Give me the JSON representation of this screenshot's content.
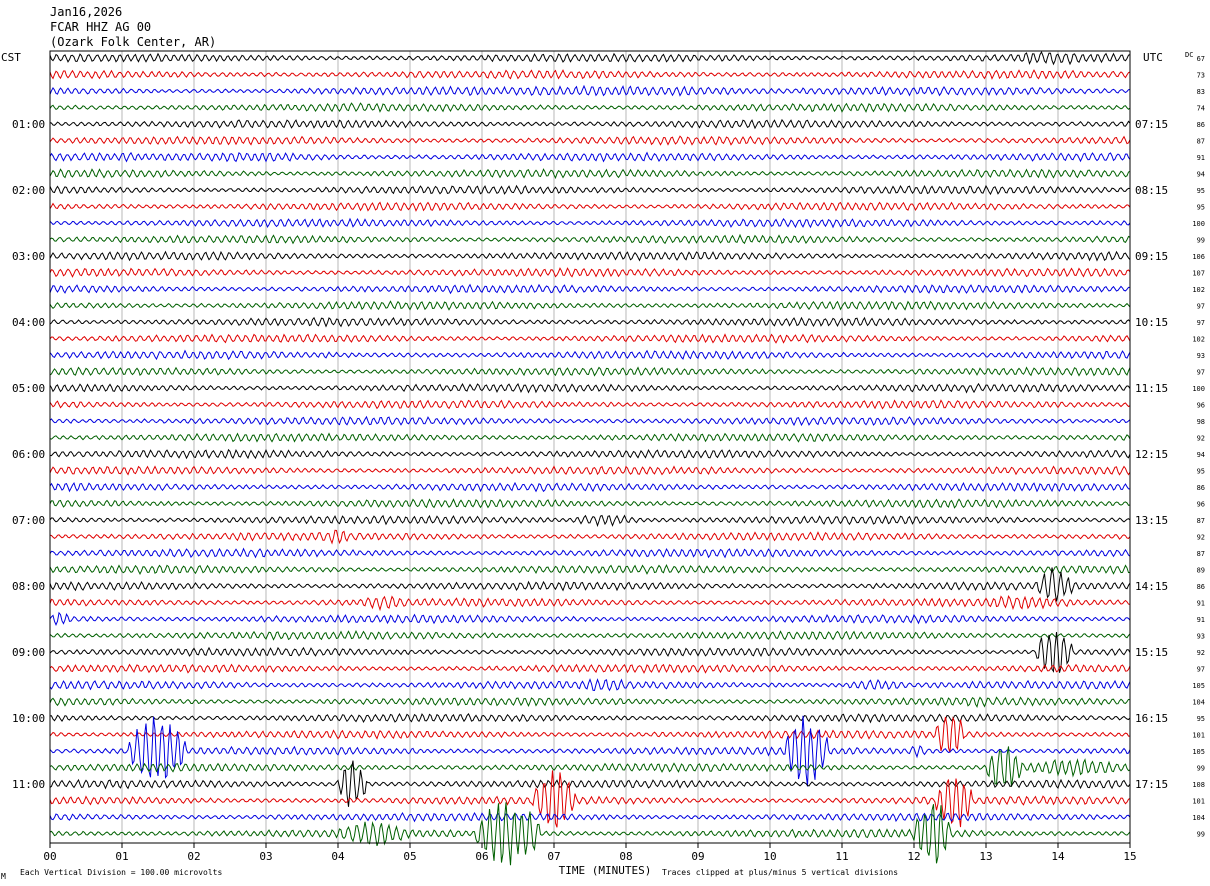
{
  "header": {
    "date": "Jan16,2026",
    "station": "FCAR HHZ AG 00",
    "location": "(Ozark Folk Center, AR)"
  },
  "axes": {
    "left_tz": "CST",
    "right_tz": "UTC",
    "dc_label": "DC",
    "xlabel": "TIME (MINUTES)",
    "xticks": [
      "00",
      "01",
      "02",
      "03",
      "04",
      "05",
      "06",
      "07",
      "08",
      "09",
      "10",
      "11",
      "12",
      "13",
      "14",
      "15"
    ]
  },
  "footer": {
    "left_note": "Each Vertical Division =  100.00 microvolts",
    "right_note": "Traces clipped at plus/minus 5 vertical divisions",
    "corner_mark": "M"
  },
  "colors": {
    "trace_cycle": [
      "#000000",
      "#e00000",
      "#0000e0",
      "#006000"
    ],
    "grid": "#888888"
  },
  "chart_data": {
    "type": "helicorder",
    "title": "FCAR HHZ AG 00 (Ozark Folk Center, AR) Jan16,2026",
    "xlabel": "TIME (MINUTES)",
    "xlim": [
      0,
      15
    ],
    "minutes_per_line": 15,
    "left_hour_labels": [
      {
        "line": 4,
        "label": "01:00"
      },
      {
        "line": 8,
        "label": "02:00"
      },
      {
        "line": 12,
        "label": "03:00"
      },
      {
        "line": 16,
        "label": "04:00"
      },
      {
        "line": 20,
        "label": "05:00"
      },
      {
        "line": 24,
        "label": "06:00"
      },
      {
        "line": 28,
        "label": "07:00"
      },
      {
        "line": 32,
        "label": "08:00"
      },
      {
        "line": 36,
        "label": "09:00"
      },
      {
        "line": 40,
        "label": "10:00"
      },
      {
        "line": 44,
        "label": "11:00"
      }
    ],
    "right_hour_labels": [
      {
        "line": 4,
        "label": "07:15"
      },
      {
        "line": 8,
        "label": "08:15"
      },
      {
        "line": 12,
        "label": "09:15"
      },
      {
        "line": 16,
        "label": "10:15"
      },
      {
        "line": 20,
        "label": "11:15"
      },
      {
        "line": 24,
        "label": "12:15"
      },
      {
        "line": 28,
        "label": "13:15"
      },
      {
        "line": 32,
        "label": "14:15"
      },
      {
        "line": 36,
        "label": "15:15"
      },
      {
        "line": 40,
        "label": "16:15"
      },
      {
        "line": 44,
        "label": "17:15"
      }
    ],
    "dc_values": [
      67,
      73,
      83,
      74,
      86,
      87,
      91,
      94,
      95,
      95,
      100,
      99,
      106,
      107,
      102,
      97,
      97,
      102,
      93,
      97,
      100,
      96,
      98,
      92,
      94,
      95,
      86,
      96,
      87,
      92,
      87,
      89,
      86,
      91,
      91,
      93,
      92,
      97,
      105,
      104,
      95,
      101,
      105,
      99,
      108,
      101,
      104,
      99
    ],
    "events": [
      {
        "line": 2,
        "start_min": 5.2,
        "end_min": 10.5,
        "amp": 1.6
      },
      {
        "line": 0,
        "start_min": 13.3,
        "end_min": 14.5,
        "amp": 2.2
      },
      {
        "line": 6,
        "start_min": 1.3,
        "end_min": 4.2,
        "amp": 1.5
      },
      {
        "line": 28,
        "start_min": 7.2,
        "end_min": 8.2,
        "amp": 1.8
      },
      {
        "line": 29,
        "start_min": 3.8,
        "end_min": 4.2,
        "amp": 2.5
      },
      {
        "line": 33,
        "start_min": 4.2,
        "end_min": 5.0,
        "amp": 2.2
      },
      {
        "line": 33,
        "start_min": 12.6,
        "end_min": 14.3,
        "amp": 2.2
      },
      {
        "line": 32,
        "start_min": 13.7,
        "end_min": 14.2,
        "amp": 6
      },
      {
        "line": 34,
        "start_min": 0.0,
        "end_min": 0.3,
        "amp": 2.5
      },
      {
        "line": 36,
        "start_min": 13.7,
        "end_min": 14.2,
        "amp": 8
      },
      {
        "line": 38,
        "start_min": 7.1,
        "end_min": 8.2,
        "amp": 2.2
      },
      {
        "line": 38,
        "start_min": 11.0,
        "end_min": 12.0,
        "amp": 1.8
      },
      {
        "line": 39,
        "start_min": 12.6,
        "end_min": 13.2,
        "amp": 2.0
      },
      {
        "line": 42,
        "start_min": 1.1,
        "end_min": 1.9,
        "amp": 12
      },
      {
        "line": 42,
        "start_min": 10.2,
        "end_min": 10.8,
        "amp": 12
      },
      {
        "line": 42,
        "start_min": 11.9,
        "end_min": 12.2,
        "amp": 2.2
      },
      {
        "line": 41,
        "start_min": 12.3,
        "end_min": 12.7,
        "amp": 8
      },
      {
        "line": 44,
        "start_min": 4.0,
        "end_min": 4.4,
        "amp": 8
      },
      {
        "line": 45,
        "start_min": 6.7,
        "end_min": 7.3,
        "amp": 10
      },
      {
        "line": 45,
        "start_min": 12.3,
        "end_min": 12.8,
        "amp": 10
      },
      {
        "line": 43,
        "start_min": 13.0,
        "end_min": 13.5,
        "amp": 8
      },
      {
        "line": 43,
        "start_min": 13.5,
        "end_min": 14.9,
        "amp": 3
      },
      {
        "line": 47,
        "start_min": 4.0,
        "end_min": 5.0,
        "amp": 4
      },
      {
        "line": 47,
        "start_min": 5.9,
        "end_min": 6.8,
        "amp": 11
      },
      {
        "line": 47,
        "start_min": 12.0,
        "end_min": 12.5,
        "amp": 11
      }
    ]
  }
}
